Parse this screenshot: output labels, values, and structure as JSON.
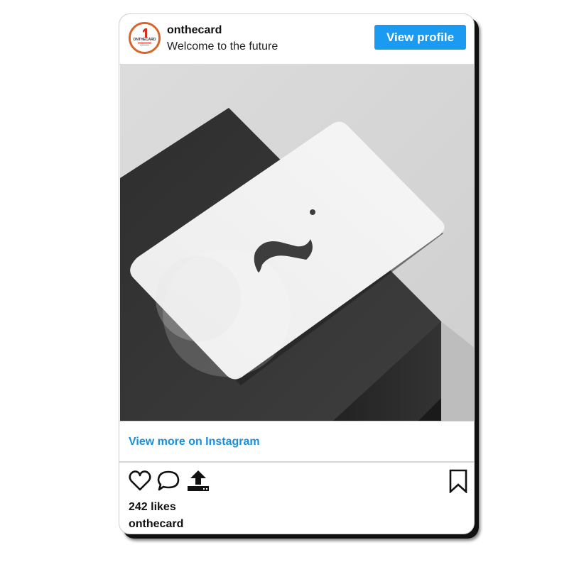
{
  "post": {
    "username": "onthecard",
    "tagline": "Welcome to the future",
    "view_profile_label": "View profile",
    "view_more_label": "View more on Instagram",
    "likes_text": "242 likes",
    "caption_username": "onthecard",
    "avatar_text": "ONTHECARD"
  },
  "icons": {
    "like": "heart-icon",
    "comment": "comment-icon",
    "share": "share-icon",
    "save": "bookmark-icon"
  },
  "colors": {
    "accent": "#1a9af0",
    "link": "#1a8ed8",
    "avatar_ring": "#d9652b"
  }
}
